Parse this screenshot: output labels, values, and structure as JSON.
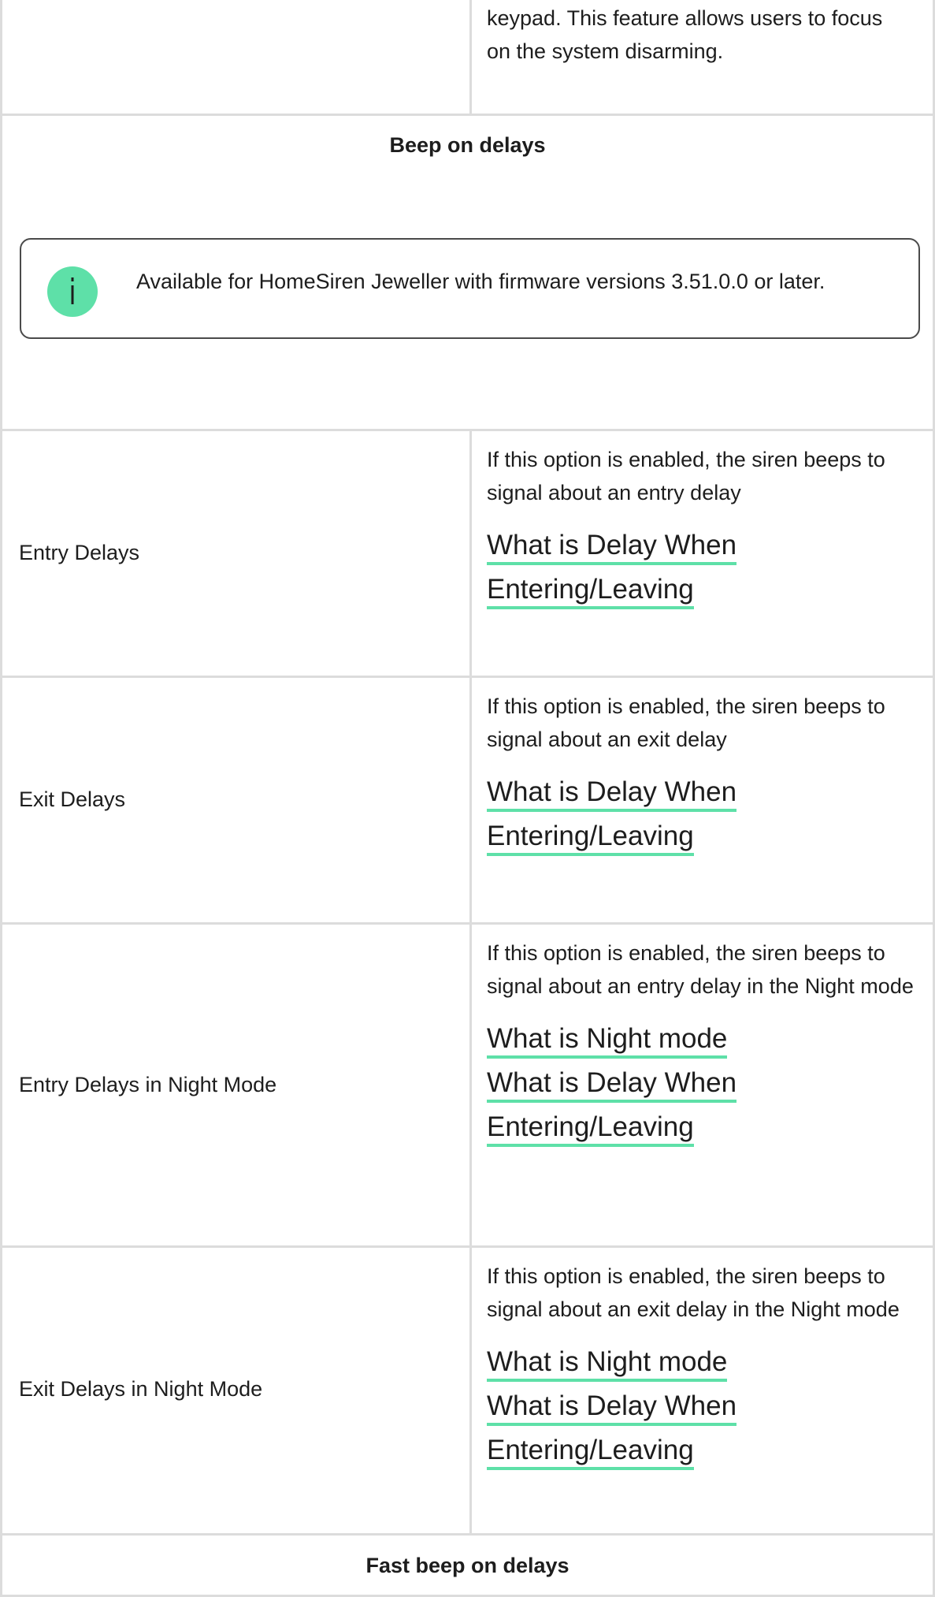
{
  "intro": {
    "text_line1": "keypad. This feature allows users to focus",
    "text_line2": "on the system disarming."
  },
  "beep_section": {
    "heading": "Beep on delays",
    "notice": "Available for HomeSiren Jeweller with firmware versions 3.51.0.0 or later.",
    "notice_icon": "info-icon",
    "accent_color": "#5ee0a8"
  },
  "rows": [
    {
      "label": "Entry Delays",
      "description": "If this option is enabled, the siren beeps to signal about an entry delay",
      "links": [
        "What is Delay When Entering/Leaving"
      ]
    },
    {
      "label": "Exit Delays",
      "description": "If this option is enabled, the siren beeps to signal about an exit delay",
      "links": [
        "What is Delay When Entering/Leaving"
      ]
    },
    {
      "label": "Entry Delays in Night Mode",
      "description": "If this option is enabled, the siren beeps to signal about an entry delay in the Night mode",
      "links": [
        "What is Night mode",
        "What is Delay When Entering/Leaving"
      ]
    },
    {
      "label": "Exit Delays in Night Mode",
      "description": "If this option is enabled, the siren beeps to signal about an exit delay in the Night mode",
      "links": [
        "What is Night mode",
        "What is Delay When Entering/Leaving"
      ]
    }
  ],
  "fast_beep_section": {
    "heading": "Fast beep on delays"
  }
}
